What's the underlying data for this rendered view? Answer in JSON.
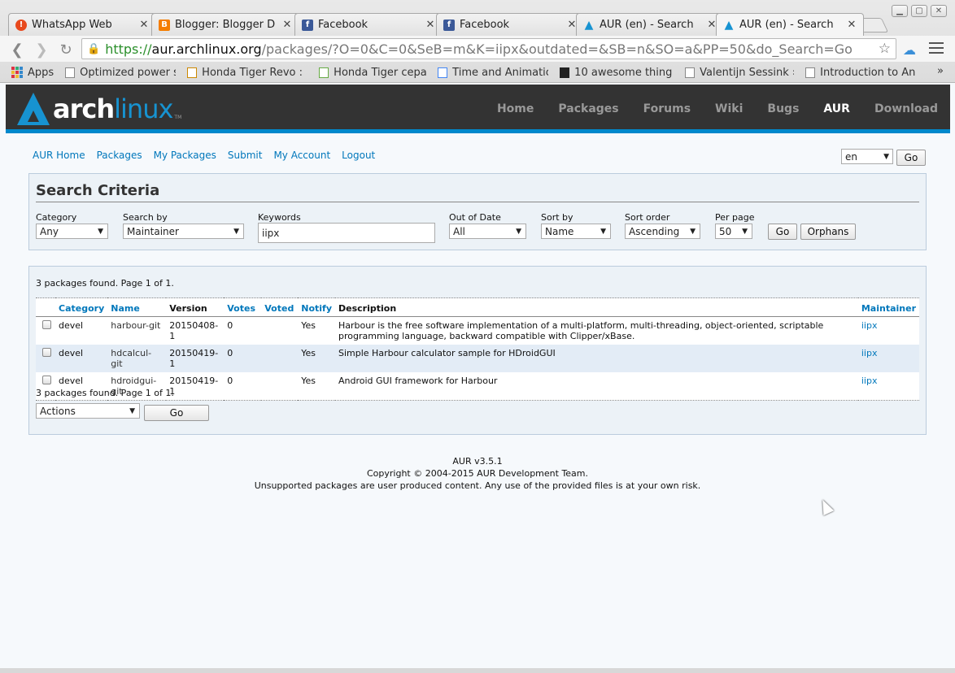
{
  "browser": {
    "tabs": [
      {
        "label": "WhatsApp Web",
        "icon": "whatsapp-alert-icon"
      },
      {
        "label": "Blogger: Blogger D",
        "icon": "blogger-icon"
      },
      {
        "label": "Facebook",
        "icon": "facebook-icon"
      },
      {
        "label": "Facebook",
        "icon": "facebook-icon"
      },
      {
        "label": "AUR (en) - Search",
        "icon": "arch-icon"
      },
      {
        "label": "AUR (en) - Search",
        "icon": "arch-icon"
      }
    ],
    "url_scheme": "https://",
    "url_host": "aur.archlinux.org",
    "url_path": "/packages/?O=0&C=0&SeB=m&K=iipx&outdated=&SB=n&SO=a&PP=50&do_Search=Go",
    "bookmarks": [
      "Apps",
      "Optimized power s",
      "Honda Tiger Revo :",
      "Honda Tiger cepat",
      "Time and Animatic",
      "10 awesome thing",
      "Valentijn Sessink »",
      "Introduction to An"
    ],
    "more": "»"
  },
  "arch": {
    "logo_arch": "arch",
    "logo_linux": "linux",
    "logo_tm": "TM",
    "nav": [
      "Home",
      "Packages",
      "Forums",
      "Wiki",
      "Bugs",
      "AUR",
      "Download"
    ]
  },
  "aur_nav": [
    "AUR Home",
    "Packages",
    "My Packages",
    "Submit",
    "My Account",
    "Logout"
  ],
  "language": {
    "value": "en",
    "go": "Go"
  },
  "search": {
    "title": "Search Criteria",
    "category_label": "Category",
    "category_value": "Any",
    "searchby_label": "Search by",
    "searchby_value": "Maintainer",
    "keywords_label": "Keywords",
    "keywords_value": "iipx",
    "outofdate_label": "Out of Date",
    "outofdate_value": "All",
    "sortby_label": "Sort by",
    "sortby_value": "Name",
    "sortorder_label": "Sort order",
    "sortorder_value": "Ascending",
    "perpage_label": "Per page",
    "perpage_value": "50",
    "go": "Go",
    "orphans": "Orphans"
  },
  "results": {
    "count_text": "3 packages found. Page 1 of 1.",
    "headers": [
      "Category",
      "Name",
      "Version",
      "Votes",
      "Voted",
      "Notify",
      "Description",
      "Maintainer"
    ],
    "rows": [
      {
        "category": "devel",
        "name": "harbour-git",
        "version": "20150408-1",
        "votes": "0",
        "voted": "",
        "notify": "Yes",
        "description": "Harbour is the free software implementation of a multi-platform, multi-threading, object-oriented, scriptable programming language, backward compatible with Clipper/xBase.",
        "maintainer": "iipx"
      },
      {
        "category": "devel",
        "name": "hdcalcul-git",
        "version": "20150419-1",
        "votes": "0",
        "voted": "",
        "notify": "Yes",
        "description": "Simple Harbour calculator sample for HDroidGUI",
        "maintainer": "iipx"
      },
      {
        "category": "devel",
        "name": "hdroidgui-git",
        "version": "20150419-1",
        "votes": "0",
        "voted": "",
        "notify": "Yes",
        "description": "Android GUI framework for Harbour",
        "maintainer": "iipx"
      }
    ],
    "actions_value": "Actions",
    "go": "Go"
  },
  "footer": {
    "version": "AUR v3.5.1",
    "copyright": "Copyright © 2004-2015 AUR Development Team.",
    "disclaimer": "Unsupported packages are user produced content. Any use of the provided files is at your own risk."
  }
}
